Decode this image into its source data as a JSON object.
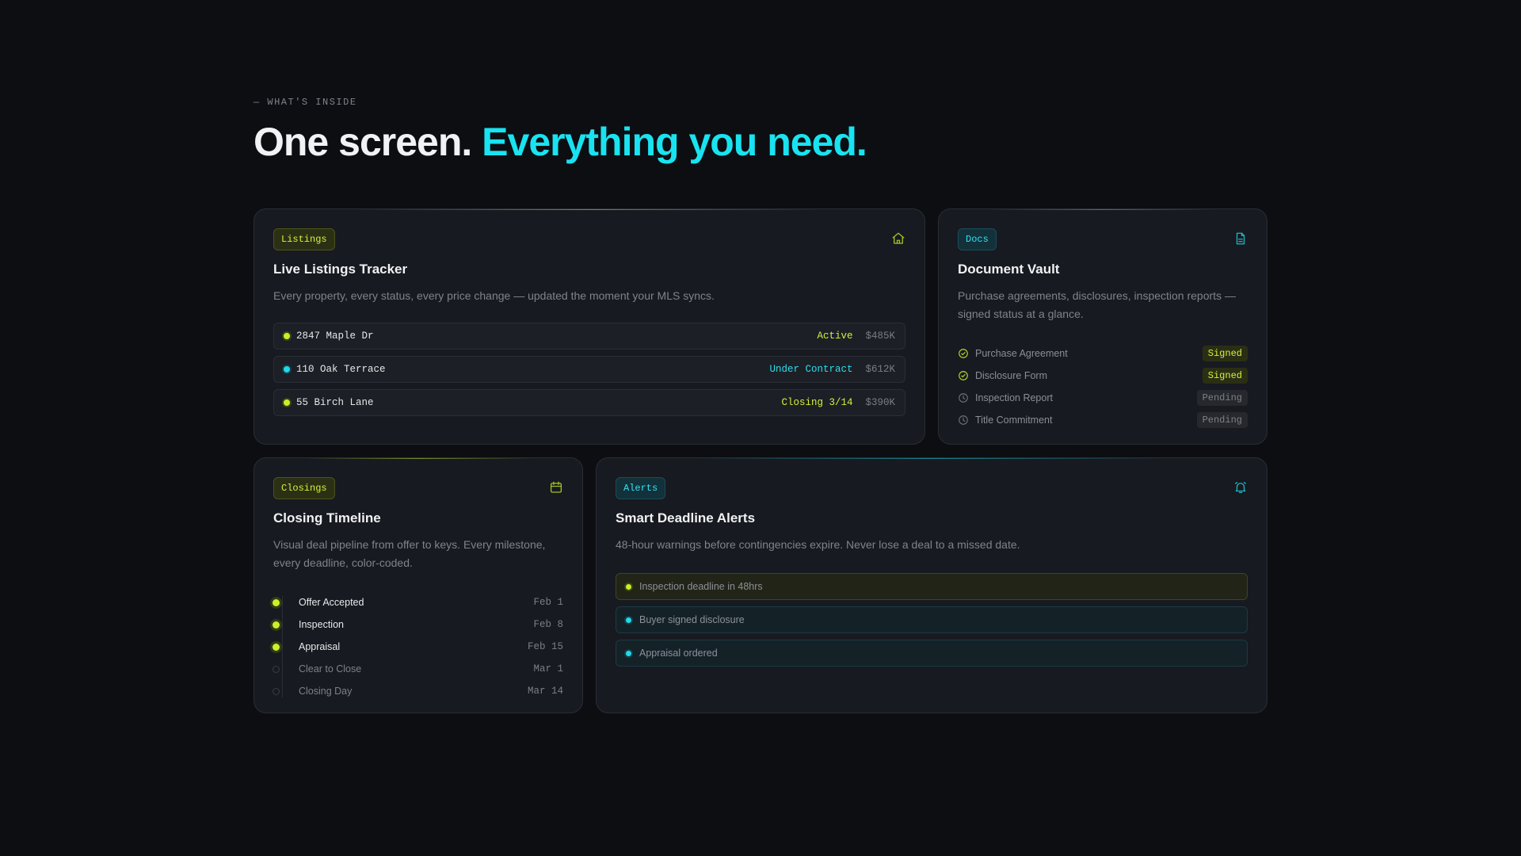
{
  "header": {
    "eyebrow": "— WHAT'S INSIDE",
    "headline_main": "One screen. ",
    "headline_accent": "Everything you need."
  },
  "listings_card": {
    "tag": "Listings",
    "icon": "home-icon",
    "title": "Live Listings Tracker",
    "description": "Every property, every status, every price change — updated the moment your MLS syncs.",
    "rows": [
      {
        "address": "2847 Maple Dr",
        "status": "Active",
        "price": "$485K",
        "color": "#c9ef2b"
      },
      {
        "address": "110 Oak Terrace",
        "status": "Under Contract",
        "price": "$612K",
        "color": "#22d8ec"
      },
      {
        "address": "55 Birch Lane",
        "status": "Closing 3/14",
        "price": "$390K",
        "color": "#c9ef2b"
      }
    ]
  },
  "docs_card": {
    "tag": "Docs",
    "icon": "document-icon",
    "title": "Document Vault",
    "description": "Purchase agreements, disclosures, inspection reports — signed status at a glance.",
    "rows": [
      {
        "name": "Purchase Agreement",
        "status": "Signed"
      },
      {
        "name": "Disclosure Form",
        "status": "Signed"
      },
      {
        "name": "Inspection Report",
        "status": "Pending"
      },
      {
        "name": "Title Commitment",
        "status": "Pending"
      }
    ]
  },
  "closings_card": {
    "tag": "Closings",
    "icon": "calendar-icon",
    "title": "Closing Timeline",
    "description": "Visual deal pipeline from offer to keys. Every milestone, every deadline, color-coded.",
    "steps": [
      {
        "label": "Offer Accepted",
        "date": "Feb 1",
        "done": true
      },
      {
        "label": "Inspection",
        "date": "Feb 8",
        "done": true
      },
      {
        "label": "Appraisal",
        "date": "Feb 15",
        "done": true
      },
      {
        "label": "Clear to Close",
        "date": "Mar 1",
        "done": false
      },
      {
        "label": "Closing Day",
        "date": "Mar 14",
        "done": false
      }
    ]
  },
  "alerts_card": {
    "tag": "Alerts",
    "icon": "alarm-bell-icon",
    "title": "Smart Deadline Alerts",
    "description": "48-hour warnings before contingencies expire. Never lose a deal to a missed date.",
    "alerts": [
      {
        "text": "Inspection deadline in 48hrs",
        "level": "warning"
      },
      {
        "text": "Buyer signed disclosure",
        "level": "info"
      },
      {
        "text": "Appraisal ordered",
        "level": "info"
      }
    ]
  },
  "colors": {
    "accent_cyan": "#19e3f0",
    "accent_lime": "#c9ef2b",
    "background": "#0c0e12",
    "card": "#171a20"
  }
}
